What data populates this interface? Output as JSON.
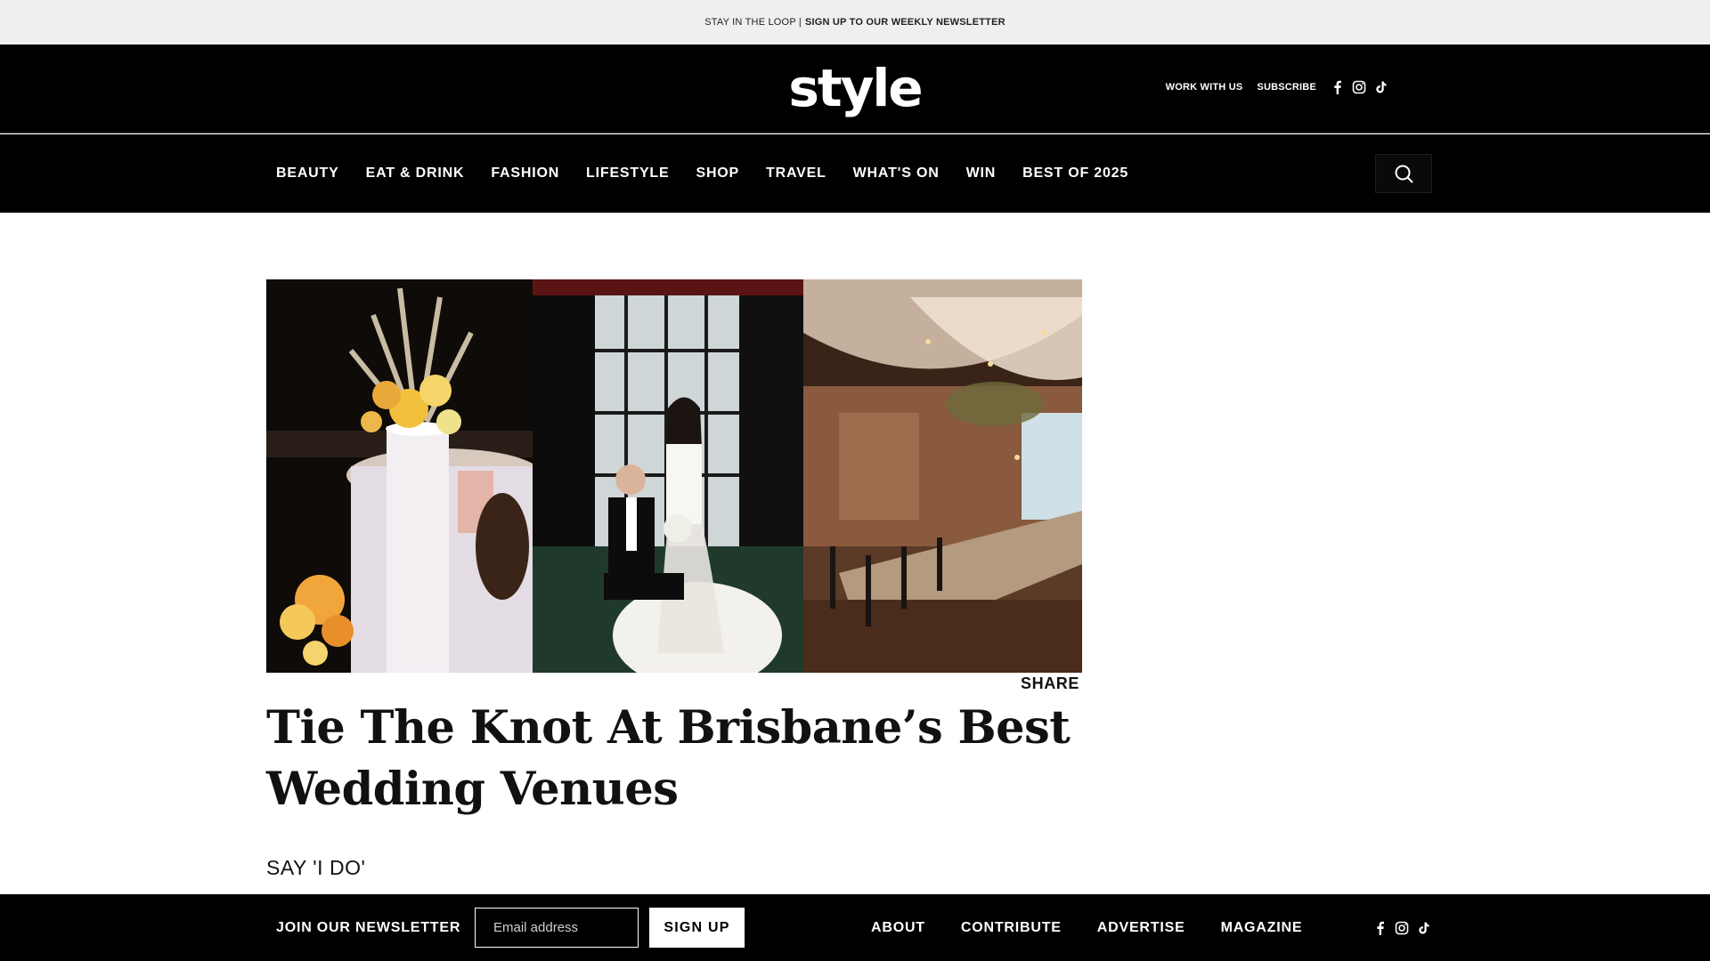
{
  "topbar": {
    "text": "STAY IN THE LOOP |",
    "cta": "SIGN UP TO OUR WEEKLY NEWSLETTER"
  },
  "header": {
    "logo": "style",
    "links": [
      "WORK WITH US",
      "SUBSCRIBE"
    ],
    "social_icons": [
      "facebook-icon",
      "instagram-icon",
      "tiktok-icon"
    ]
  },
  "nav": {
    "items": [
      "BEAUTY",
      "EAT & DRINK",
      "FASHION",
      "LIFESTYLE",
      "SHOP",
      "TRAVEL",
      "WHAT'S ON",
      "WIN",
      "BEST OF 2025"
    ],
    "search_icon": "search-icon"
  },
  "article": {
    "share_label": "SHARE",
    "title": "Tie The Knot At Brisbane’s Best Wedding Venues",
    "subtitle": "SAY 'I DO'"
  },
  "footer": {
    "newsletter_label": "JOIN OUR NEWSLETTER",
    "email_placeholder": "Email address",
    "signup_label": "SIGN UP",
    "links": [
      "ABOUT",
      "CONTRIBUTE",
      "ADVERTISE",
      "MAGAZINE"
    ],
    "social_icons": [
      "facebook-icon",
      "instagram-icon",
      "tiktok-icon"
    ]
  },
  "colors": {
    "header_bg": "#000000",
    "topbar_bg": "#efefef",
    "accent": "#ffffff"
  }
}
